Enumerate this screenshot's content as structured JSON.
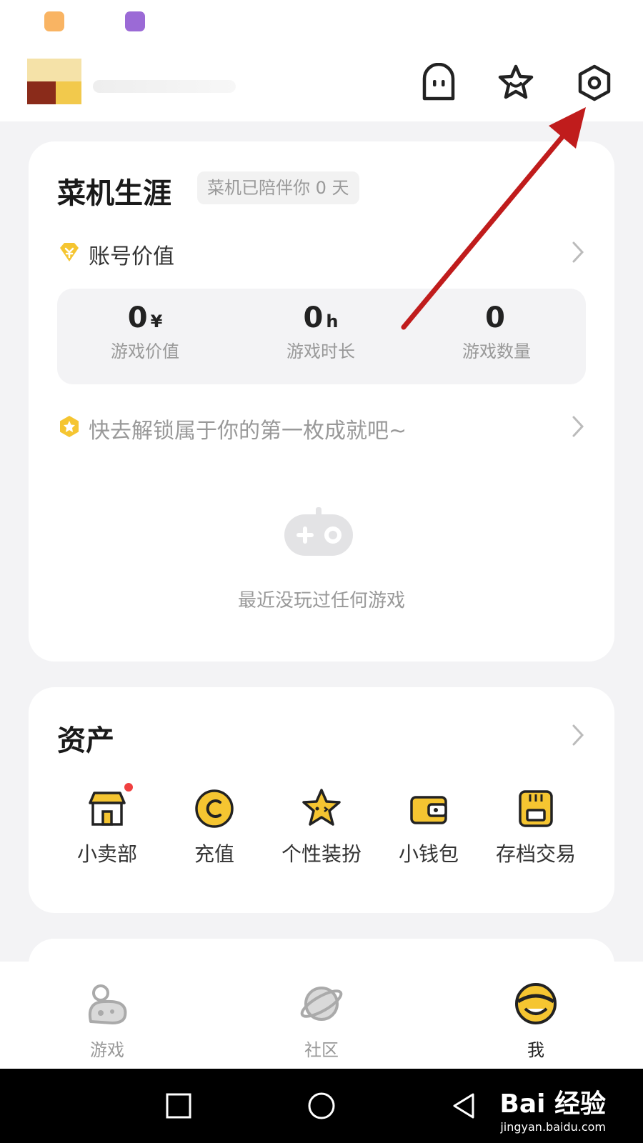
{
  "career": {
    "title": "菜机生涯",
    "badge": "菜机已陪伴你 0 天",
    "account_value_label": "账号价值",
    "stats": [
      {
        "value": "0",
        "unit": "¥",
        "label": "游戏价值"
      },
      {
        "value": "0",
        "unit": "h",
        "label": "游戏时长"
      },
      {
        "value": "0",
        "unit": "",
        "label": "游戏数量"
      }
    ],
    "achievement_text": "快去解锁属于你的第一枚成就吧~",
    "empty_text": "最近没玩过任何游戏"
  },
  "assets": {
    "title": "资产",
    "items": [
      {
        "label": "小卖部",
        "icon": "shop-icon"
      },
      {
        "label": "充值",
        "icon": "coin-icon"
      },
      {
        "label": "个性装扮",
        "icon": "star-costume-icon"
      },
      {
        "label": "小钱包",
        "icon": "wallet-icon"
      },
      {
        "label": "存档交易",
        "icon": "save-file-icon"
      }
    ]
  },
  "tabs": [
    {
      "label": "游戏",
      "icon": "game-tab-icon"
    },
    {
      "label": "社区",
      "icon": "planet-icon"
    },
    {
      "label": "我",
      "icon": "me-avatar-icon"
    }
  ],
  "watermark": {
    "line1": "Bai 经验",
    "line2": "jingyan.baidu.com"
  },
  "colors": {
    "accent": "#f5c531",
    "arrow": "#c01c1c"
  }
}
